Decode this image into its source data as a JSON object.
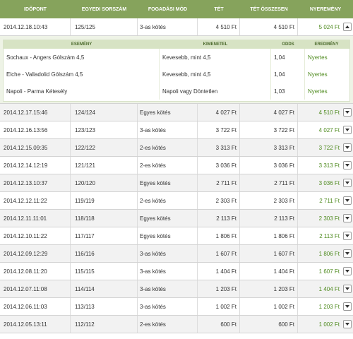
{
  "columns": {
    "date": "IDŐPONT",
    "serial": "EGYEDI SORSZÁM",
    "mode": "FOGADÁSI MÓD",
    "stake": "TÉT",
    "total": "TÉT ÖSSZESEN",
    "win": "NYEREMÉNY"
  },
  "expanded": {
    "date": "2014.12.18.10:43",
    "serial": "125/125",
    "mode": "3-as kötés",
    "stake": "4 510 Ft",
    "total": "4 510 Ft",
    "win": "5 024 Ft"
  },
  "detail": {
    "headers": {
      "event": "ESEMÉNY",
      "outcome": "KIMENETEL",
      "odds": "ODDS",
      "result": "EREDMÉNY"
    },
    "rows": [
      {
        "event": "Sochaux - Angers Gólszám 4,5",
        "outcome": "Kevesebb, mint 4,5",
        "odds": "1,04",
        "result": "Nyertes"
      },
      {
        "event": "Elche - Valladolid Gólszám 4,5",
        "outcome": "Kevesebb, mint 4,5",
        "odds": "1,04",
        "result": "Nyertes"
      },
      {
        "event": "Napoli - Parma Kétesély",
        "outcome": "Napoli vagy Döntetlen",
        "odds": "1,03",
        "result": "Nyertes"
      }
    ]
  },
  "rows": [
    {
      "date": "2014.12.17.15:46",
      "serial": "124/124",
      "mode": "Egyes kötés",
      "stake": "4 027 Ft",
      "total": "4 027 Ft",
      "win": "4 510 Ft"
    },
    {
      "date": "2014.12.16.13:56",
      "serial": "123/123",
      "mode": "3-as kötés",
      "stake": "3 722 Ft",
      "total": "3 722 Ft",
      "win": "4 027 Ft"
    },
    {
      "date": "2014.12.15.09:35",
      "serial": "122/122",
      "mode": "2-es kötés",
      "stake": "3 313 Ft",
      "total": "3 313 Ft",
      "win": "3 722 Ft"
    },
    {
      "date": "2014.12.14.12:19",
      "serial": "121/121",
      "mode": "2-es kötés",
      "stake": "3 036 Ft",
      "total": "3 036 Ft",
      "win": "3 313 Ft"
    },
    {
      "date": "2014.12.13.10:37",
      "serial": "120/120",
      "mode": "Egyes kötés",
      "stake": "2 711 Ft",
      "total": "2 711 Ft",
      "win": "3 036 Ft"
    },
    {
      "date": "2014.12.12.11:22",
      "serial": "119/119",
      "mode": "2-es kötés",
      "stake": "2 303 Ft",
      "total": "2 303 Ft",
      "win": "2 711 Ft"
    },
    {
      "date": "2014.12.11.11:01",
      "serial": "118/118",
      "mode": "Egyes kötés",
      "stake": "2 113 Ft",
      "total": "2 113 Ft",
      "win": "2 303 Ft"
    },
    {
      "date": "2014.12.10.11:22",
      "serial": "117/117",
      "mode": "Egyes kötés",
      "stake": "1 806 Ft",
      "total": "1 806 Ft",
      "win": "2 113 Ft"
    },
    {
      "date": "2014.12.09.12:29",
      "serial": "116/116",
      "mode": "3-as kötés",
      "stake": "1 607 Ft",
      "total": "1 607 Ft",
      "win": "1 806 Ft"
    },
    {
      "date": "2014.12.08.11:20",
      "serial": "115/115",
      "mode": "3-as kötés",
      "stake": "1 404 Ft",
      "total": "1 404 Ft",
      "win": "1 607 Ft"
    },
    {
      "date": "2014.12.07.11:08",
      "serial": "114/114",
      "mode": "3-as kötés",
      "stake": "1 203 Ft",
      "total": "1 203 Ft",
      "win": "1 404 Ft"
    },
    {
      "date": "2014.12.06.11:03",
      "serial": "113/113",
      "mode": "3-as kötés",
      "stake": "1 002 Ft",
      "total": "1 002 Ft",
      "win": "1 203 Ft"
    },
    {
      "date": "2014.12.05.13:11",
      "serial": "112/112",
      "mode": "2-es kötés",
      "stake": "600 Ft",
      "total": "600 Ft",
      "win": "1 002 Ft"
    }
  ],
  "colors": {
    "header_bg": "#86a35c",
    "win_green": "#4e8a1e",
    "detail_bg": "#eef3e6"
  },
  "icons": {
    "collapse": "chevron-up-icon",
    "expand": "chevron-down-icon"
  }
}
